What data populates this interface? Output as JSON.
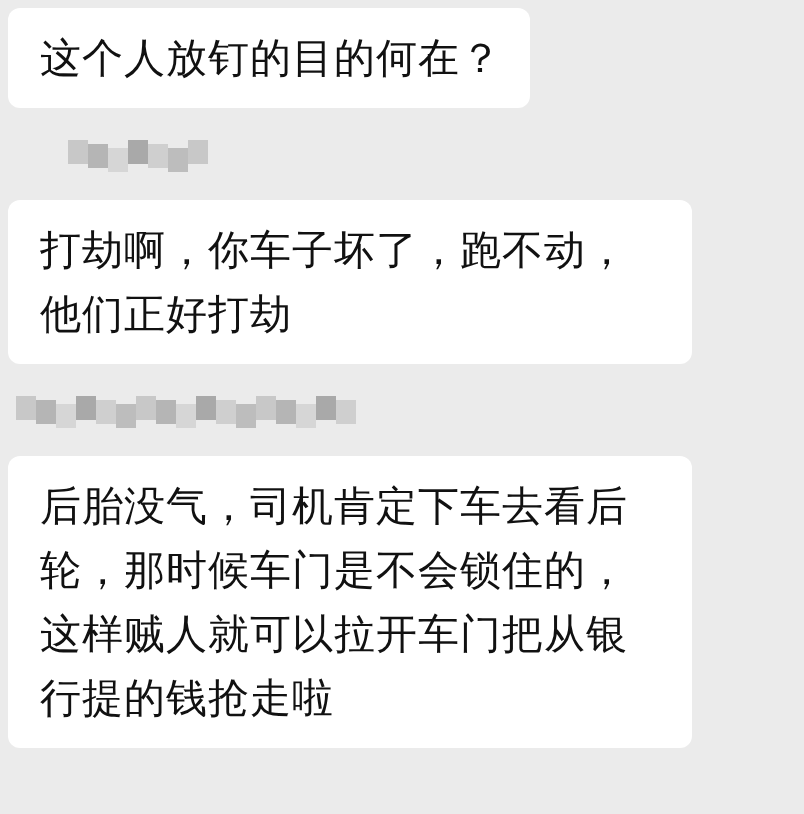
{
  "chat": [
    {
      "kind": "message",
      "text": "这个人放钉的目的何在？"
    },
    {
      "kind": "blurred_name"
    },
    {
      "kind": "message",
      "text": "打劫啊，你车子坏了，跑不动，他们正好打劫"
    },
    {
      "kind": "blurred_name"
    },
    {
      "kind": "message",
      "text": "后胎没气，司机肯定下车去看后轮，那时候车门是不会锁住的，这样贼人就可以拉开车门把从银行提的钱抢走啦"
    }
  ]
}
